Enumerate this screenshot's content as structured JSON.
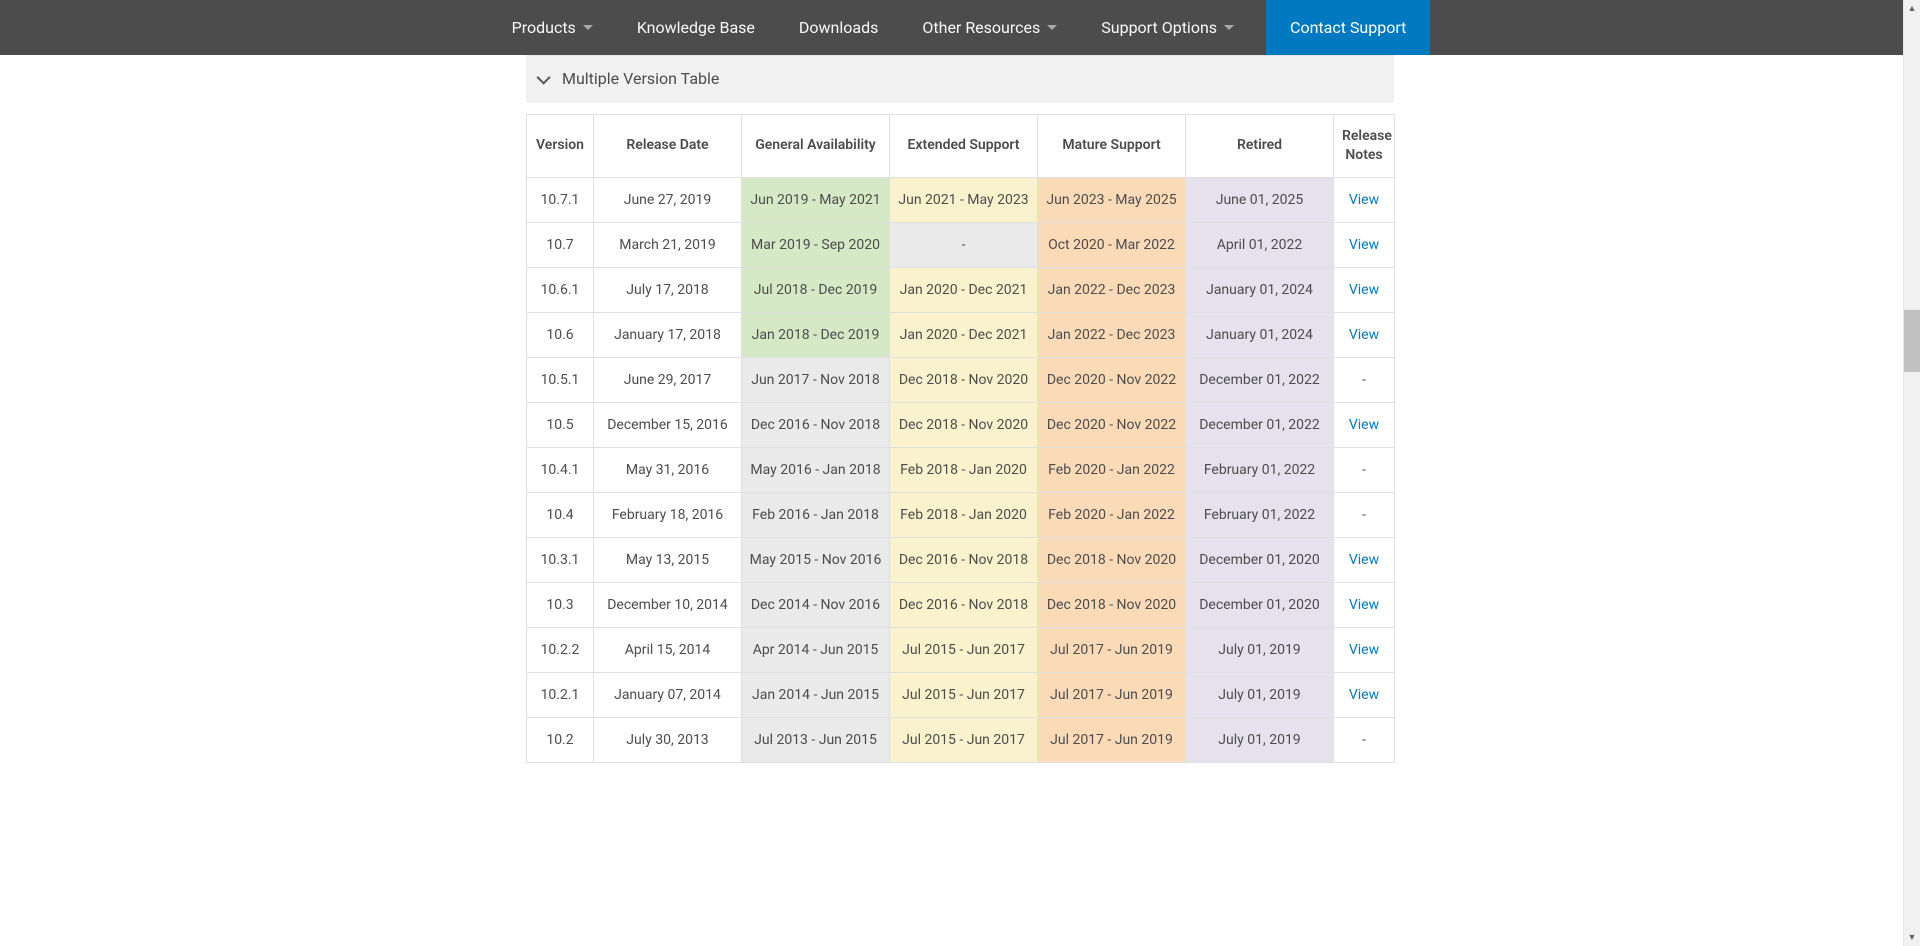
{
  "nav": {
    "products": "Products",
    "kb": "Knowledge Base",
    "downloads": "Downloads",
    "other": "Other Resources",
    "support": "Support Options",
    "contact": "Contact Support"
  },
  "accordion": {
    "title": "Multiple Version Table"
  },
  "table": {
    "headers": {
      "version": "Version",
      "release": "Release Date",
      "ga": "General Availability",
      "ext": "Extended Support",
      "mat": "Mature Support",
      "ret": "Retired",
      "notes": "Release Notes"
    },
    "view_label": "View",
    "dash": "-",
    "rows": [
      {
        "version": "10.7.1",
        "release": "June 27, 2019",
        "ga": "Jun 2019 - May 2021",
        "ext": "Jun 2021 - May 2023",
        "mat": "Jun 2023 - May 2025",
        "ret": "June 01, 2025",
        "ga_cls": "bg-green",
        "ext_cls": "bg-yellow",
        "mat_cls": "bg-orange",
        "ret_cls": "bg-purple",
        "has_view": true
      },
      {
        "version": "10.7",
        "release": "March 21, 2019",
        "ga": "Mar 2019 - Sep 2020",
        "ext": "-",
        "mat": "Oct 2020 - Mar 2022",
        "ret": "April 01, 2022",
        "ga_cls": "bg-green",
        "ext_cls": "bg-gray",
        "mat_cls": "bg-orange",
        "ret_cls": "bg-purple",
        "has_view": true
      },
      {
        "version": "10.6.1",
        "release": "July 17, 2018",
        "ga": "Jul 2018 - Dec 2019",
        "ext": "Jan 2020 - Dec 2021",
        "mat": "Jan 2022 - Dec 2023",
        "ret": "January 01, 2024",
        "ga_cls": "bg-green",
        "ext_cls": "bg-yellow",
        "mat_cls": "bg-orange",
        "ret_cls": "bg-purple",
        "has_view": true
      },
      {
        "version": "10.6",
        "release": "January 17, 2018",
        "ga": "Jan 2018 - Dec 2019",
        "ext": "Jan 2020 - Dec 2021",
        "mat": "Jan 2022 - Dec 2023",
        "ret": "January 01, 2024",
        "ga_cls": "bg-green",
        "ext_cls": "bg-yellow",
        "mat_cls": "bg-orange",
        "ret_cls": "bg-purple",
        "has_view": true
      },
      {
        "version": "10.5.1",
        "release": "June 29, 2017",
        "ga": "Jun 2017 - Nov 2018",
        "ext": "Dec 2018 - Nov 2020",
        "mat": "Dec 2020 - Nov 2022",
        "ret": "December 01, 2022",
        "ga_cls": "bg-gray",
        "ext_cls": "bg-yellow",
        "mat_cls": "bg-orange",
        "ret_cls": "bg-purple",
        "has_view": false
      },
      {
        "version": "10.5",
        "release": "December 15, 2016",
        "ga": "Dec 2016 - Nov 2018",
        "ext": "Dec 2018 - Nov 2020",
        "mat": "Dec 2020 - Nov 2022",
        "ret": "December 01, 2022",
        "ga_cls": "bg-gray",
        "ext_cls": "bg-yellow",
        "mat_cls": "bg-orange",
        "ret_cls": "bg-purple",
        "has_view": true
      },
      {
        "version": "10.4.1",
        "release": "May 31, 2016",
        "ga": "May 2016 - Jan 2018",
        "ext": "Feb 2018 - Jan 2020",
        "mat": "Feb 2020 - Jan 2022",
        "ret": "February 01, 2022",
        "ga_cls": "bg-gray",
        "ext_cls": "bg-yellow",
        "mat_cls": "bg-orange",
        "ret_cls": "bg-purple",
        "has_view": false
      },
      {
        "version": "10.4",
        "release": "February 18, 2016",
        "ga": "Feb 2016 - Jan 2018",
        "ext": "Feb 2018 - Jan 2020",
        "mat": "Feb 2020 - Jan 2022",
        "ret": "February 01, 2022",
        "ga_cls": "bg-gray",
        "ext_cls": "bg-yellow",
        "mat_cls": "bg-orange",
        "ret_cls": "bg-purple",
        "has_view": false
      },
      {
        "version": "10.3.1",
        "release": "May 13, 2015",
        "ga": "May 2015 - Nov 2016",
        "ext": "Dec 2016 - Nov 2018",
        "mat": "Dec 2018 - Nov 2020",
        "ret": "December 01, 2020",
        "ga_cls": "bg-gray",
        "ext_cls": "bg-yellow",
        "mat_cls": "bg-orange",
        "ret_cls": "bg-purple",
        "has_view": true
      },
      {
        "version": "10.3",
        "release": "December 10, 2014",
        "ga": "Dec 2014 - Nov 2016",
        "ext": "Dec 2016 - Nov 2018",
        "mat": "Dec 2018 - Nov 2020",
        "ret": "December 01, 2020",
        "ga_cls": "bg-gray",
        "ext_cls": "bg-yellow",
        "mat_cls": "bg-orange",
        "ret_cls": "bg-purple",
        "has_view": true
      },
      {
        "version": "10.2.2",
        "release": "April 15, 2014",
        "ga": "Apr 2014 - Jun 2015",
        "ext": "Jul 2015 - Jun 2017",
        "mat": "Jul 2017 - Jun 2019",
        "ret": "July 01, 2019",
        "ga_cls": "bg-gray",
        "ext_cls": "bg-yellow",
        "mat_cls": "bg-orange",
        "ret_cls": "bg-purple",
        "has_view": true
      },
      {
        "version": "10.2.1",
        "release": "January 07, 2014",
        "ga": "Jan 2014 - Jun 2015",
        "ext": "Jul 2015 - Jun 2017",
        "mat": "Jul 2017 - Jun 2019",
        "ret": "July 01, 2019",
        "ga_cls": "bg-gray",
        "ext_cls": "bg-yellow",
        "mat_cls": "bg-orange",
        "ret_cls": "bg-purple",
        "has_view": true
      },
      {
        "version": "10.2",
        "release": "July 30, 2013",
        "ga": "Jul 2013 - Jun 2015",
        "ext": "Jul 2015 - Jun 2017",
        "mat": "Jul 2017 - Jun 2019",
        "ret": "July 01, 2019",
        "ga_cls": "bg-gray",
        "ext_cls": "bg-yellow",
        "mat_cls": "bg-orange",
        "ret_cls": "bg-purple",
        "has_view": false
      }
    ]
  }
}
